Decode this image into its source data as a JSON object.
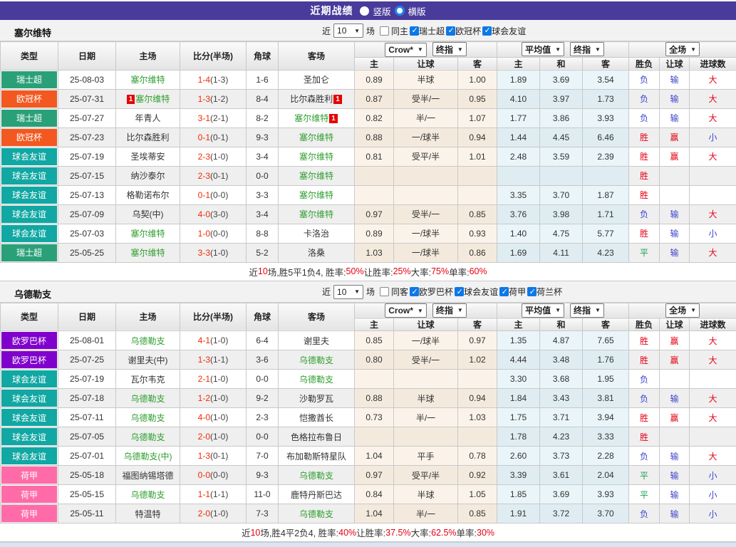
{
  "topbar": {
    "title": "近期战绩",
    "options": [
      {
        "label": "竖版",
        "selected": false
      },
      {
        "label": "横版",
        "selected": true
      }
    ]
  },
  "colors": {
    "league": {
      "瑞士超": "#2aa079",
      "欧冠杯": "#f2581f",
      "球会友谊": "#11a7a3",
      "欧罗巴杯": "#8000cc",
      "荷甲": "#ff6ba8"
    },
    "result_map": {
      "胜": "#e60012",
      "赢": "#e60012",
      "大": "#e60012",
      "负": "#3d44cc",
      "输": "#3d44cc",
      "小": "#3d44cc",
      "平": "#1e9e4e"
    },
    "team_focus": "#2f9e2f",
    "score_fulltime": "#f42a00",
    "topbar_bg": "#493b9b",
    "checkbox_on": "#0d78e7",
    "radio_selected": "#1c86ee",
    "card_marker": "#e60000"
  },
  "table_headers": {
    "left": [
      "类型",
      "日期",
      "主场",
      "比分(半场)",
      "角球",
      "客场"
    ],
    "odds_dropdowns": [
      "Crow*",
      "终指"
    ],
    "odds_cols": [
      "主",
      "让球",
      "客"
    ],
    "avg_dropdowns": [
      "平均值",
      "终指"
    ],
    "avg_cols": [
      "主",
      "和",
      "客"
    ],
    "result_dropdowns": [
      "全场"
    ],
    "result_cols": [
      "胜负",
      "让球",
      "进球数"
    ]
  },
  "sections": [
    {
      "team": "塞尔维特",
      "filter": {
        "recent": "近",
        "count": "10",
        "matches": "场",
        "same": {
          "label": "同主",
          "checked": false
        },
        "leagues": [
          {
            "label": "瑞士超",
            "checked": true
          },
          {
            "label": "欧冠杯",
            "checked": true
          },
          {
            "label": "球会友谊",
            "checked": true
          }
        ]
      },
      "rows": [
        {
          "lg": "瑞士超",
          "date": "25-08-03",
          "home": "塞尔维特",
          "hf": true,
          "ft": "1-4",
          "ht": "(1-3)",
          "cn": "1-6",
          "away": "圣加仑",
          "od": [
            "0.89",
            "半球",
            "1.00"
          ],
          "av": [
            "1.89",
            "3.69",
            "3.54"
          ],
          "rs": [
            "负",
            "输",
            "大"
          ]
        },
        {
          "lg": "欧冠杯",
          "date": "25-07-31",
          "home": "塞尔维特",
          "hf": true,
          "hc1": "1",
          "ft": "1-3",
          "ht": "(1-2)",
          "cn": "8-4",
          "away": "比尔森胜利",
          "ac2": "1",
          "od": [
            "0.87",
            "受半/一",
            "0.95"
          ],
          "av": [
            "4.10",
            "3.97",
            "1.73"
          ],
          "rs": [
            "负",
            "输",
            "大"
          ]
        },
        {
          "lg": "瑞士超",
          "date": "25-07-27",
          "home": "年青人",
          "ft": "3-1",
          "ht": "(2-1)",
          "cn": "8-2",
          "away": "塞尔维特",
          "af": true,
          "ac2": "1",
          "od": [
            "0.82",
            "半/一",
            "1.07"
          ],
          "av": [
            "1.77",
            "3.86",
            "3.93"
          ],
          "rs": [
            "负",
            "输",
            "大"
          ]
        },
        {
          "lg": "欧冠杯",
          "date": "25-07-23",
          "home": "比尔森胜利",
          "ft": "0-1",
          "ht": "(0-1)",
          "cn": "9-3",
          "away": "塞尔维特",
          "af": true,
          "od": [
            "0.88",
            "一/球半",
            "0.94"
          ],
          "av": [
            "1.44",
            "4.45",
            "6.46"
          ],
          "rs": [
            "胜",
            "赢",
            "小"
          ]
        },
        {
          "lg": "球会友谊",
          "date": "25-07-19",
          "home": "圣埃蒂安",
          "ft": "2-3",
          "ht": "(1-0)",
          "cn": "3-4",
          "away": "塞尔维特",
          "af": true,
          "od": [
            "0.81",
            "受平/半",
            "1.01"
          ],
          "av": [
            "2.48",
            "3.59",
            "2.39"
          ],
          "rs": [
            "胜",
            "赢",
            "大"
          ]
        },
        {
          "lg": "球会友谊",
          "date": "25-07-15",
          "home": "纳沙泰尔",
          "ft": "2-3",
          "ht": "(0-1)",
          "cn": "0-0",
          "away": "塞尔维特",
          "af": true,
          "od": [
            "",
            "",
            ""
          ],
          "av": [
            "",
            "",
            ""
          ],
          "rs": [
            "胜",
            "",
            ""
          ]
        },
        {
          "lg": "球会友谊",
          "date": "25-07-13",
          "home": "格勒诺布尔",
          "ft": "0-1",
          "ht": "(0-0)",
          "cn": "3-3",
          "away": "塞尔维特",
          "af": true,
          "od": [
            "",
            "",
            ""
          ],
          "av": [
            "3.35",
            "3.70",
            "1.87"
          ],
          "rs": [
            "胜",
            "",
            ""
          ]
        },
        {
          "lg": "球会友谊",
          "date": "25-07-09",
          "home": "乌契(中)",
          "ft": "4-0",
          "ht": "(3-0)",
          "cn": "3-4",
          "away": "塞尔维特",
          "af": true,
          "od": [
            "0.97",
            "受半/一",
            "0.85"
          ],
          "av": [
            "3.76",
            "3.98",
            "1.71"
          ],
          "rs": [
            "负",
            "输",
            "大"
          ]
        },
        {
          "lg": "球会友谊",
          "date": "25-07-03",
          "home": "塞尔维特",
          "hf": true,
          "ft": "1-0",
          "ht": "(0-0)",
          "cn": "8-8",
          "away": "卡洛治",
          "od": [
            "0.89",
            "一/球半",
            "0.93"
          ],
          "av": [
            "1.40",
            "4.75",
            "5.77"
          ],
          "rs": [
            "胜",
            "输",
            "小"
          ]
        },
        {
          "lg": "瑞士超",
          "date": "25-05-25",
          "home": "塞尔维特",
          "hf": true,
          "ft": "3-3",
          "ht": "(1-0)",
          "cn": "5-2",
          "away": "洛桑",
          "od": [
            "1.03",
            "一/球半",
            "0.86"
          ],
          "av": [
            "1.69",
            "4.11",
            "4.23"
          ],
          "rs": [
            "平",
            "输",
            "大"
          ]
        }
      ],
      "summary": [
        {
          "text": "近",
          "red": false
        },
        {
          "text": "10",
          "red": true
        },
        {
          "text": "场,胜5平1负4, 胜率:",
          "red": false
        },
        {
          "text": "50%",
          "red": true
        },
        {
          "text": " 让胜率:",
          "red": false
        },
        {
          "text": "25%",
          "red": true
        },
        {
          "text": " 大率:",
          "red": false
        },
        {
          "text": "75%",
          "red": true
        },
        {
          "text": " 单率:",
          "red": false
        },
        {
          "text": "60%",
          "red": true
        }
      ]
    },
    {
      "team": "乌德勒支",
      "filter": {
        "recent": "近",
        "count": "10",
        "matches": "场",
        "same": {
          "label": "同客",
          "checked": false
        },
        "leagues": [
          {
            "label": "欧罗巴杯",
            "checked": true
          },
          {
            "label": "球会友谊",
            "checked": true
          },
          {
            "label": "荷甲",
            "checked": true
          },
          {
            "label": "荷兰杯",
            "checked": true
          }
        ]
      },
      "rows": [
        {
          "lg": "欧罗巴杯",
          "date": "25-08-01",
          "home": "乌德勒支",
          "hf": true,
          "ft": "4-1",
          "ht": "(1-0)",
          "cn": "6-4",
          "away": "谢里夫",
          "od": [
            "0.85",
            "一/球半",
            "0.97"
          ],
          "av": [
            "1.35",
            "4.87",
            "7.65"
          ],
          "rs": [
            "胜",
            "赢",
            "大"
          ]
        },
        {
          "lg": "欧罗巴杯",
          "date": "25-07-25",
          "home": "谢里夫(中)",
          "ft": "1-3",
          "ht": "(1-1)",
          "cn": "3-6",
          "away": "乌德勒支",
          "af": true,
          "od": [
            "0.80",
            "受半/一",
            "1.02"
          ],
          "av": [
            "4.44",
            "3.48",
            "1.76"
          ],
          "rs": [
            "胜",
            "赢",
            "大"
          ]
        },
        {
          "lg": "球会友谊",
          "date": "25-07-19",
          "home": "瓦尔韦克",
          "ft": "2-1",
          "ht": "(1-0)",
          "cn": "0-0",
          "away": "乌德勒支",
          "af": true,
          "od": [
            "",
            "",
            ""
          ],
          "av": [
            "3.30",
            "3.68",
            "1.95"
          ],
          "rs": [
            "负",
            "",
            ""
          ]
        },
        {
          "lg": "球会友谊",
          "date": "25-07-18",
          "home": "乌德勒支",
          "hf": true,
          "ft": "1-2",
          "ht": "(1-0)",
          "cn": "9-2",
          "away": "沙勒罗瓦",
          "od": [
            "0.88",
            "半球",
            "0.94"
          ],
          "av": [
            "1.84",
            "3.43",
            "3.81"
          ],
          "rs": [
            "负",
            "输",
            "大"
          ]
        },
        {
          "lg": "球会友谊",
          "date": "25-07-11",
          "home": "乌德勒支",
          "hf": true,
          "ft": "4-0",
          "ht": "(1-0)",
          "cn": "2-3",
          "away": "恺撒酋长",
          "od": [
            "0.73",
            "半/一",
            "1.03"
          ],
          "av": [
            "1.75",
            "3.71",
            "3.94"
          ],
          "rs": [
            "胜",
            "赢",
            "大"
          ]
        },
        {
          "lg": "球会友谊",
          "date": "25-07-05",
          "home": "乌德勒支",
          "hf": true,
          "ft": "2-0",
          "ht": "(1-0)",
          "cn": "0-0",
          "away": "色格拉布鲁日",
          "od": [
            "",
            "",
            ""
          ],
          "av": [
            "1.78",
            "4.23",
            "3.33"
          ],
          "rs": [
            "胜",
            "",
            ""
          ]
        },
        {
          "lg": "球会友谊",
          "date": "25-07-01",
          "home": "乌德勒支(中)",
          "hf": true,
          "ft": "1-3",
          "ht": "(0-1)",
          "cn": "7-0",
          "away": "布加勒斯特星队",
          "od": [
            "1.04",
            "平手",
            "0.78"
          ],
          "av": [
            "2.60",
            "3.73",
            "2.28"
          ],
          "rs": [
            "负",
            "输",
            "大"
          ]
        },
        {
          "lg": "荷甲",
          "date": "25-05-18",
          "home": "福图纳锡塔德",
          "ft": "0-0",
          "ht": "(0-0)",
          "cn": "9-3",
          "away": "乌德勒支",
          "af": true,
          "od": [
            "0.97",
            "受平/半",
            "0.92"
          ],
          "av": [
            "3.39",
            "3.61",
            "2.04"
          ],
          "rs": [
            "平",
            "输",
            "小"
          ]
        },
        {
          "lg": "荷甲",
          "date": "25-05-15",
          "home": "乌德勒支",
          "hf": true,
          "ft": "1-1",
          "ht": "(1-1)",
          "cn": "11-0",
          "away": "鹿特丹斯巴达",
          "od": [
            "0.84",
            "半球",
            "1.05"
          ],
          "av": [
            "1.85",
            "3.69",
            "3.93"
          ],
          "rs": [
            "平",
            "输",
            "小"
          ]
        },
        {
          "lg": "荷甲",
          "date": "25-05-11",
          "home": "特温特",
          "ft": "2-0",
          "ht": "(1-0)",
          "cn": "7-3",
          "away": "乌德勒支",
          "af": true,
          "od": [
            "1.04",
            "半/一",
            "0.85"
          ],
          "av": [
            "1.91",
            "3.72",
            "3.70"
          ],
          "rs": [
            "负",
            "输",
            "小"
          ]
        }
      ],
      "summary": [
        {
          "text": "近",
          "red": false
        },
        {
          "text": "10",
          "red": true
        },
        {
          "text": "场,胜4平2负4, 胜率:",
          "red": false
        },
        {
          "text": "40%",
          "red": true
        },
        {
          "text": " 让胜率:",
          "red": false
        },
        {
          "text": "37.5%",
          "red": true
        },
        {
          "text": " 大率:",
          "red": false
        },
        {
          "text": "62.5%",
          "red": true
        },
        {
          "text": " 单率:",
          "red": false
        },
        {
          "text": "30%",
          "red": true
        }
      ]
    }
  ]
}
